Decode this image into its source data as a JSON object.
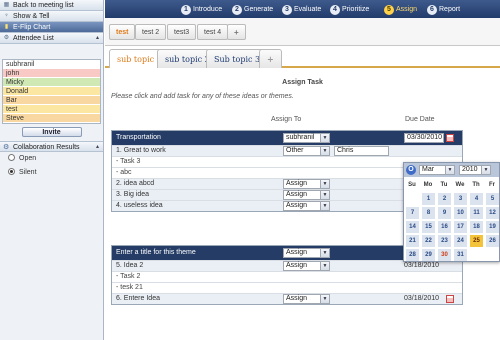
{
  "sidebar": {
    "buttons": [
      {
        "label": "Back to meeting list",
        "icon": "grid-icon"
      },
      {
        "label": "Show & Tell",
        "icon": "pin-icon"
      },
      {
        "label": "E-Flip Chart",
        "icon": "chart-icon"
      },
      {
        "label": "Attendee List",
        "icon": "gear-icon"
      }
    ],
    "attendees": [
      {
        "name": "subhranil",
        "color": "white"
      },
      {
        "name": "john",
        "color": "pink"
      },
      {
        "name": "Micky",
        "color": "green"
      },
      {
        "name": "Donald",
        "color": "yellow"
      },
      {
        "name": "Bar",
        "color": "orange"
      },
      {
        "name": "test",
        "color": "yellow"
      },
      {
        "name": "Steve",
        "color": "orange"
      }
    ],
    "invite_label": "Invite",
    "collab_label": "Collaboration Results",
    "radios": [
      {
        "label": "Open",
        "checked": false
      },
      {
        "label": "Silent",
        "checked": true
      }
    ]
  },
  "steps": [
    {
      "num": "1",
      "label": "Introduce"
    },
    {
      "num": "2",
      "label": "Generate"
    },
    {
      "num": "3",
      "label": "Evaluate"
    },
    {
      "num": "4",
      "label": "Prioritize"
    },
    {
      "num": "5",
      "label": "Assign",
      "active": true
    },
    {
      "num": "6",
      "label": "Report"
    }
  ],
  "topic_tabs": [
    "test",
    "test 2",
    "test3",
    "test 4",
    "+"
  ],
  "sub_tabs": [
    "sub topic 1",
    "sub topic 2",
    "Sub topic 3",
    "+"
  ],
  "assign": {
    "title": "Assign Task",
    "instructions": "Please click and add task for any of these ideas or themes.",
    "col_assign": "Assign To",
    "col_due": "Due Date"
  },
  "group1": {
    "title": "Transportation",
    "assign_value": "subhranil",
    "due_date": "03/30/2010",
    "rows": [
      {
        "label": "1. Great to work",
        "kind": "idea",
        "assign": "Other",
        "other_text": "Chris"
      },
      {
        "label": "- Task 3",
        "kind": "sub"
      },
      {
        "label": "- abc",
        "kind": "sub"
      },
      {
        "label": "2. idea abcd",
        "kind": "idea",
        "assign": "Assign"
      },
      {
        "label": "3. Big idea",
        "kind": "idea",
        "assign": "Assign"
      },
      {
        "label": "4. useless idea",
        "kind": "idea",
        "assign": "Assign"
      }
    ]
  },
  "group2": {
    "title": "Enter a title for this theme",
    "assign_value": "Assign",
    "rows": [
      {
        "label": "5. Idea 2",
        "kind": "idea",
        "assign": "Assign",
        "due": "03/18/2010"
      },
      {
        "label": "- Task 2",
        "kind": "sub"
      },
      {
        "label": "- tesk 21",
        "kind": "sub"
      },
      {
        "label": "6. Entere Idea",
        "kind": "idea",
        "assign": "Assign",
        "due": "03/18/2010"
      }
    ]
  },
  "datepicker": {
    "month": "Mar",
    "year": "2010",
    "weekdays": [
      "Su",
      "Mo",
      "Tu",
      "We",
      "Th",
      "Fr"
    ],
    "weeks": [
      [
        "",
        "1",
        "2",
        "3",
        "4",
        "5"
      ],
      [
        "7",
        "8",
        "9",
        "10",
        "11",
        "12"
      ],
      [
        "14",
        "15",
        "16",
        "17",
        "18",
        "19"
      ],
      [
        "21",
        "22",
        "23",
        "24",
        "25",
        "26"
      ],
      [
        "28",
        "29",
        "30",
        "31",
        "",
        ""
      ]
    ],
    "today": "25",
    "selected": "30"
  }
}
